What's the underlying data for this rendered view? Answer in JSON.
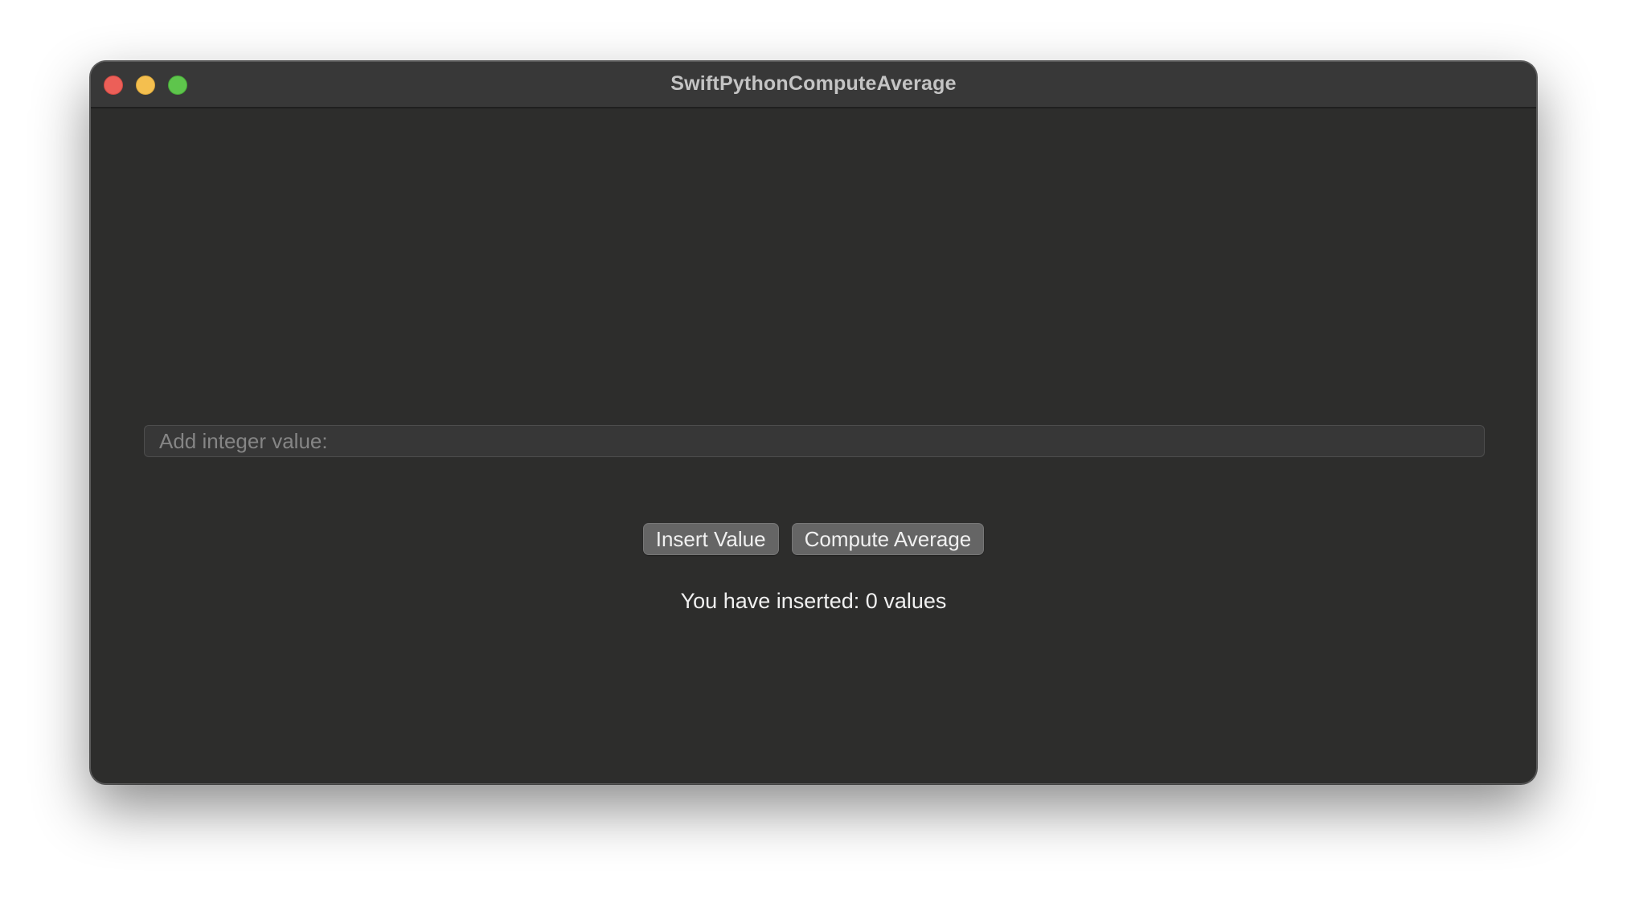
{
  "window": {
    "title": "SwiftPythonComputeAverage"
  },
  "input": {
    "value": "",
    "placeholder": "Add integer value:"
  },
  "buttons": {
    "insert_label": "Insert Value",
    "compute_label": "Compute Average"
  },
  "status": {
    "text": "You have inserted: 0 values"
  },
  "colors": {
    "window_background": "#2d2d2c",
    "titlebar": "#383838",
    "close": "#ec5f58",
    "minimize": "#f4bf4f",
    "zoom": "#5ec54c",
    "button": "#656565"
  },
  "icons": {
    "close": "close-button-icon",
    "minimize": "minimize-button-icon",
    "zoom": "zoom-button-icon"
  }
}
